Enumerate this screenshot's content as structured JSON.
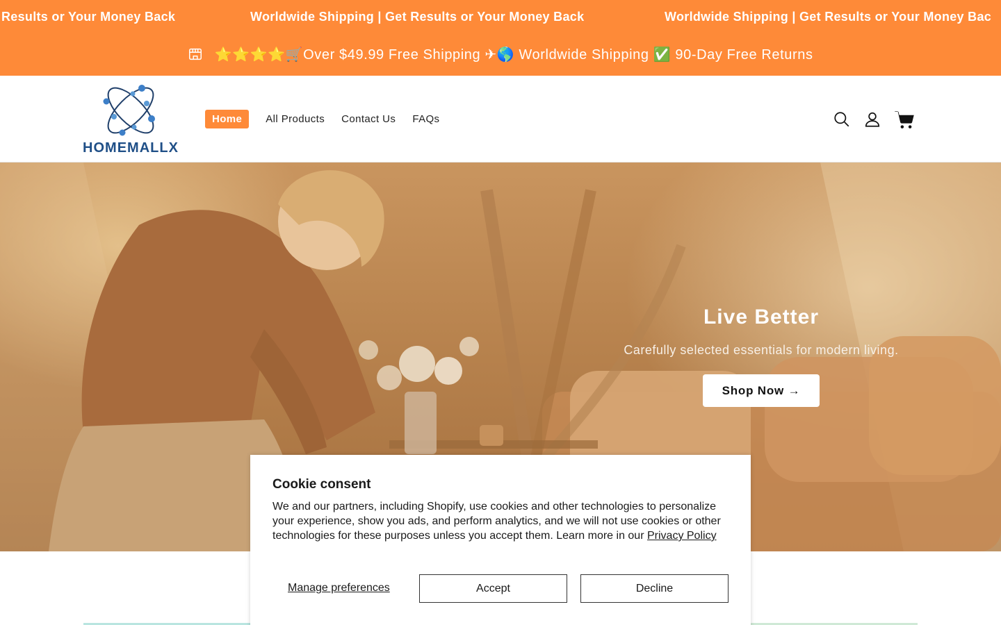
{
  "marquee": {
    "items": [
      "Results or Your Money Back",
      "Worldwide Shipping | Get Results or Your Money Back",
      "Worldwide Shipping | Get Results or Your Money Bac"
    ]
  },
  "announcement": {
    "text": "⭐⭐⭐⭐🛒Over $49.99 Free Shipping ✈🌎 Worldwide Shipping ✅ 90-Day Free Returns",
    "icon": "store-icon"
  },
  "header": {
    "logo_text": "HOMEMALLX",
    "nav": [
      {
        "label": "Home",
        "active": true
      },
      {
        "label": "All Products"
      },
      {
        "label": "Contact Us"
      },
      {
        "label": "FAQs"
      }
    ],
    "icons": [
      "search-icon",
      "account-icon",
      "cart-icon"
    ]
  },
  "hero": {
    "title": "Live Better",
    "subtitle": "Carefully selected essentials for modern living.",
    "button": "Shop Now →"
  },
  "cookie": {
    "title": "Cookie consent",
    "body": "We and our partners, including Shopify, use cookies and other technologies to personalize your experience, show you ads, and perform analytics, and we will not use cookies or other technologies for these purposes unless you accept them. Learn more in our",
    "link": "Privacy Policy",
    "manage": "Manage preferences",
    "accept": "Accept",
    "decline": "Decline"
  },
  "colors": {
    "accent": "#fe8a38",
    "logo_blue": "#1f4f87"
  }
}
